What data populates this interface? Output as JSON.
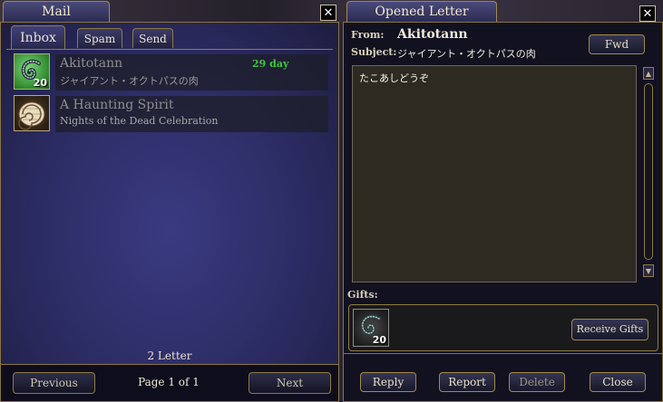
{
  "mail_window": {
    "title": "Mail",
    "close_label": "✕",
    "tabs": [
      {
        "label": "Inbox"
      },
      {
        "label": "Spam"
      },
      {
        "label": "Send"
      }
    ],
    "messages": [
      {
        "sender": "Akitotann",
        "subject": "ジャイアント・オクトパスの肉",
        "days_left": "29 day",
        "item_count": "20",
        "icon": "tentacle-item-icon"
      },
      {
        "sender": "A Haunting Spirit",
        "subject": "Nights of the Dead Celebration",
        "icon": "nautilus-shell-icon"
      }
    ],
    "letter_count": "2 Letter",
    "previous_label": "Previous",
    "page_label": "Page 1 of 1",
    "next_label": "Next"
  },
  "letter_window": {
    "title": "Opened Letter",
    "close_label": "✕",
    "from_label": "From:",
    "from_value": "Akitotann",
    "subject_label": "Subject:",
    "subject_value": "ジャイアント・オクトパスの肉",
    "fwd_label": "Fwd",
    "body": "たこあしどうぞ",
    "gifts_label": "Gifts:",
    "gift_count": "20",
    "receive_label": "Receive Gifts",
    "buttons": {
      "reply": "Reply",
      "report": "Report",
      "delete": "Delete",
      "close": "Close"
    }
  }
}
